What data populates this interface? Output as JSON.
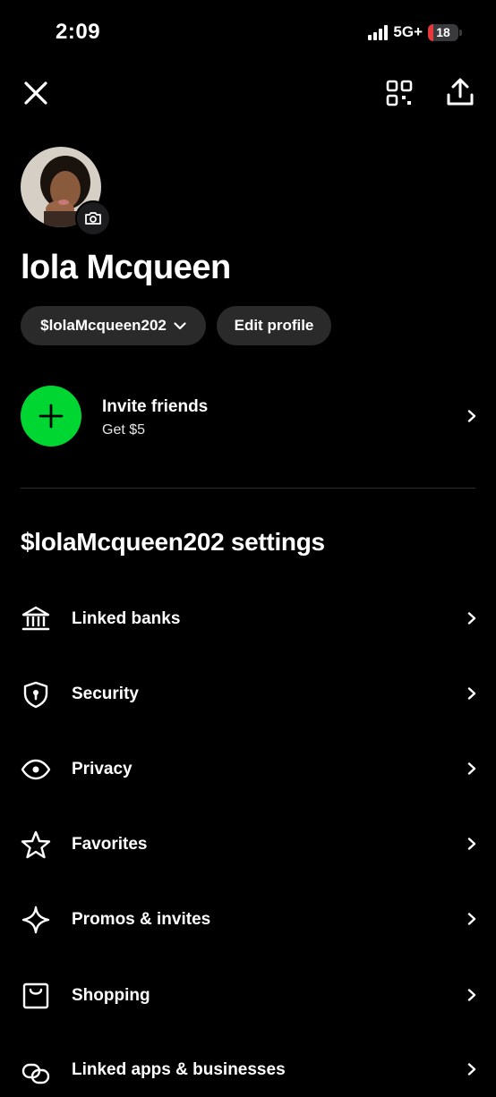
{
  "status_bar": {
    "time": "2:09",
    "network": "5G+",
    "battery": "18",
    "battery_level": 0.18
  },
  "header": {
    "close_icon": "close-icon",
    "qr_icon": "qr-scan-icon",
    "share_icon": "share-icon"
  },
  "profile": {
    "name": "lola Mcqueen",
    "cashtag": "$lolaMcqueen202",
    "edit_label": "Edit profile"
  },
  "invite": {
    "title": "Invite friends",
    "subtitle": "Get $5",
    "accent": "#00d632"
  },
  "settings": {
    "title": "$lolaMcqueen202 settings",
    "items": [
      {
        "label": "Linked banks",
        "icon": "bank-icon"
      },
      {
        "label": "Security",
        "icon": "shield-icon"
      },
      {
        "label": "Privacy",
        "icon": "eye-icon"
      },
      {
        "label": "Favorites",
        "icon": "star-icon"
      },
      {
        "label": "Promos & invites",
        "icon": "sparkle-icon"
      },
      {
        "label": "Shopping",
        "icon": "bag-icon"
      },
      {
        "label": "Linked apps & businesses",
        "icon": "link-icon"
      }
    ]
  }
}
